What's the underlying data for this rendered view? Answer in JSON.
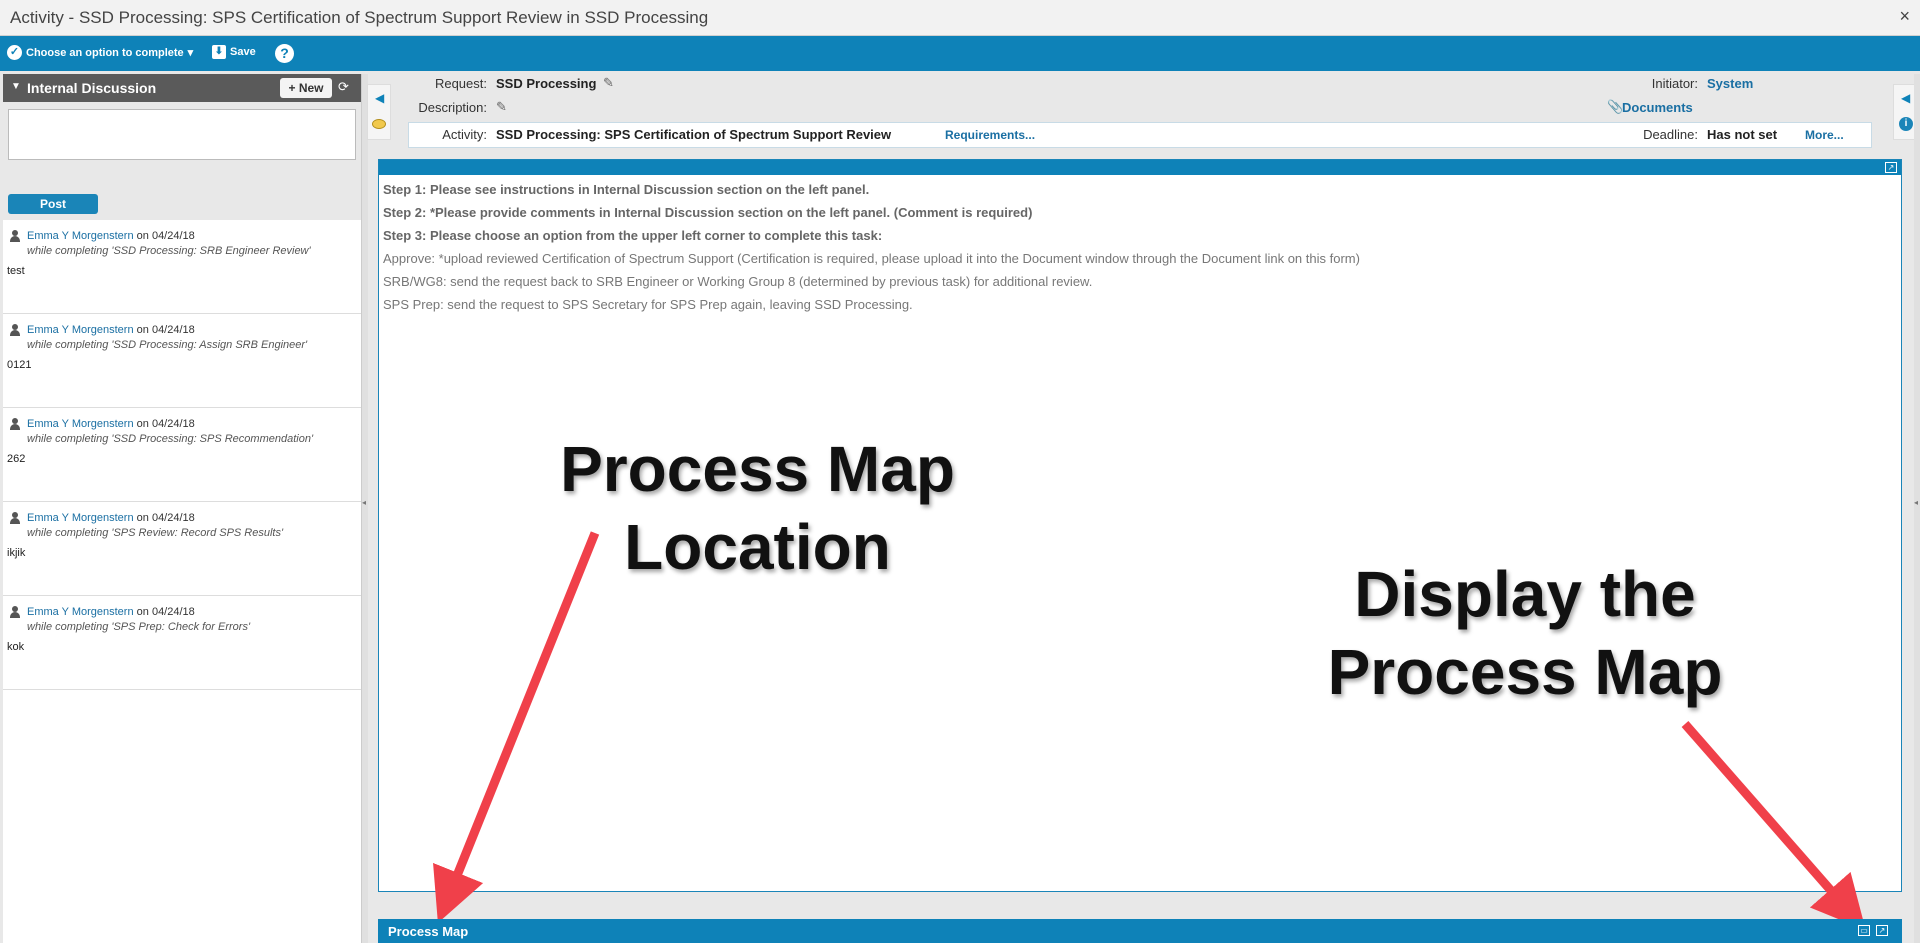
{
  "window": {
    "title": "Activity - SSD Processing: SPS Certification of Spectrum Support Review in SSD Processing",
    "close": "×"
  },
  "toolbar": {
    "complete_label": "Choose an option to complete",
    "save_label": "Save",
    "help": "?"
  },
  "discussion": {
    "title": "Internal Discussion",
    "new_label": "+ New",
    "post_label": "Post",
    "comments": [
      {
        "author": "Emma Y Morgenstern",
        "date": "on 04/24/18",
        "context": "while completing 'SSD Processing: SRB Engineer Review'",
        "text": "test"
      },
      {
        "author": "Emma Y Morgenstern",
        "date": "on 04/24/18",
        "context": "while completing 'SSD Processing: Assign SRB Engineer'",
        "text": "0121"
      },
      {
        "author": "Emma Y Morgenstern",
        "date": "on 04/24/18",
        "context": "while completing 'SSD Processing: SPS Recommendation'",
        "text": "262"
      },
      {
        "author": "Emma Y Morgenstern",
        "date": "on 04/24/18",
        "context": "while completing 'SPS Review: Record SPS Results'",
        "text": "ikjik"
      },
      {
        "author": "Emma Y Morgenstern",
        "date": "on 04/24/18",
        "context": "while completing 'SPS Prep: Check for Errors'",
        "text": "kok"
      }
    ]
  },
  "header": {
    "request_label": "Request:",
    "request_value": "SSD Processing",
    "description_label": "Description:",
    "activity_label": "Activity:",
    "activity_value": "SSD Processing: SPS Certification of Spectrum Support Review",
    "requirements_link": "Requirements...",
    "initiator_label": "Initiator:",
    "initiator_value": "System",
    "documents_link": "Documents",
    "deadline_label": "Deadline:",
    "deadline_value": "Has not set",
    "more_link": "More..."
  },
  "instructions": {
    "step1": "Step 1: Please see instructions in Internal Discussion section on the left panel.",
    "step2": "Step 2: *Please provide comments in Internal Discussion section on the left panel. (Comment is required)",
    "step3": "Step 3: Please choose an option from the upper left corner to complete this task:",
    "approve": "Approve: *upload reviewed Certification of Spectrum Support (Certification is required, please upload it into the Document window through the Document link on this form)",
    "srb": "SRB/WG8: send the request back to SRB Engineer or Working Group 8 (determined by previous task) for additional review.",
    "sps": "SPS Prep: send the request to SPS Secretary for SPS Prep again, leaving SSD Processing."
  },
  "annotations": {
    "location_line1": "Process Map",
    "location_line2": "Location",
    "display_line1": "Display the",
    "display_line2": "Process Map",
    "arrow_color": "#f0404a"
  },
  "process_map": {
    "title": "Process Map"
  }
}
